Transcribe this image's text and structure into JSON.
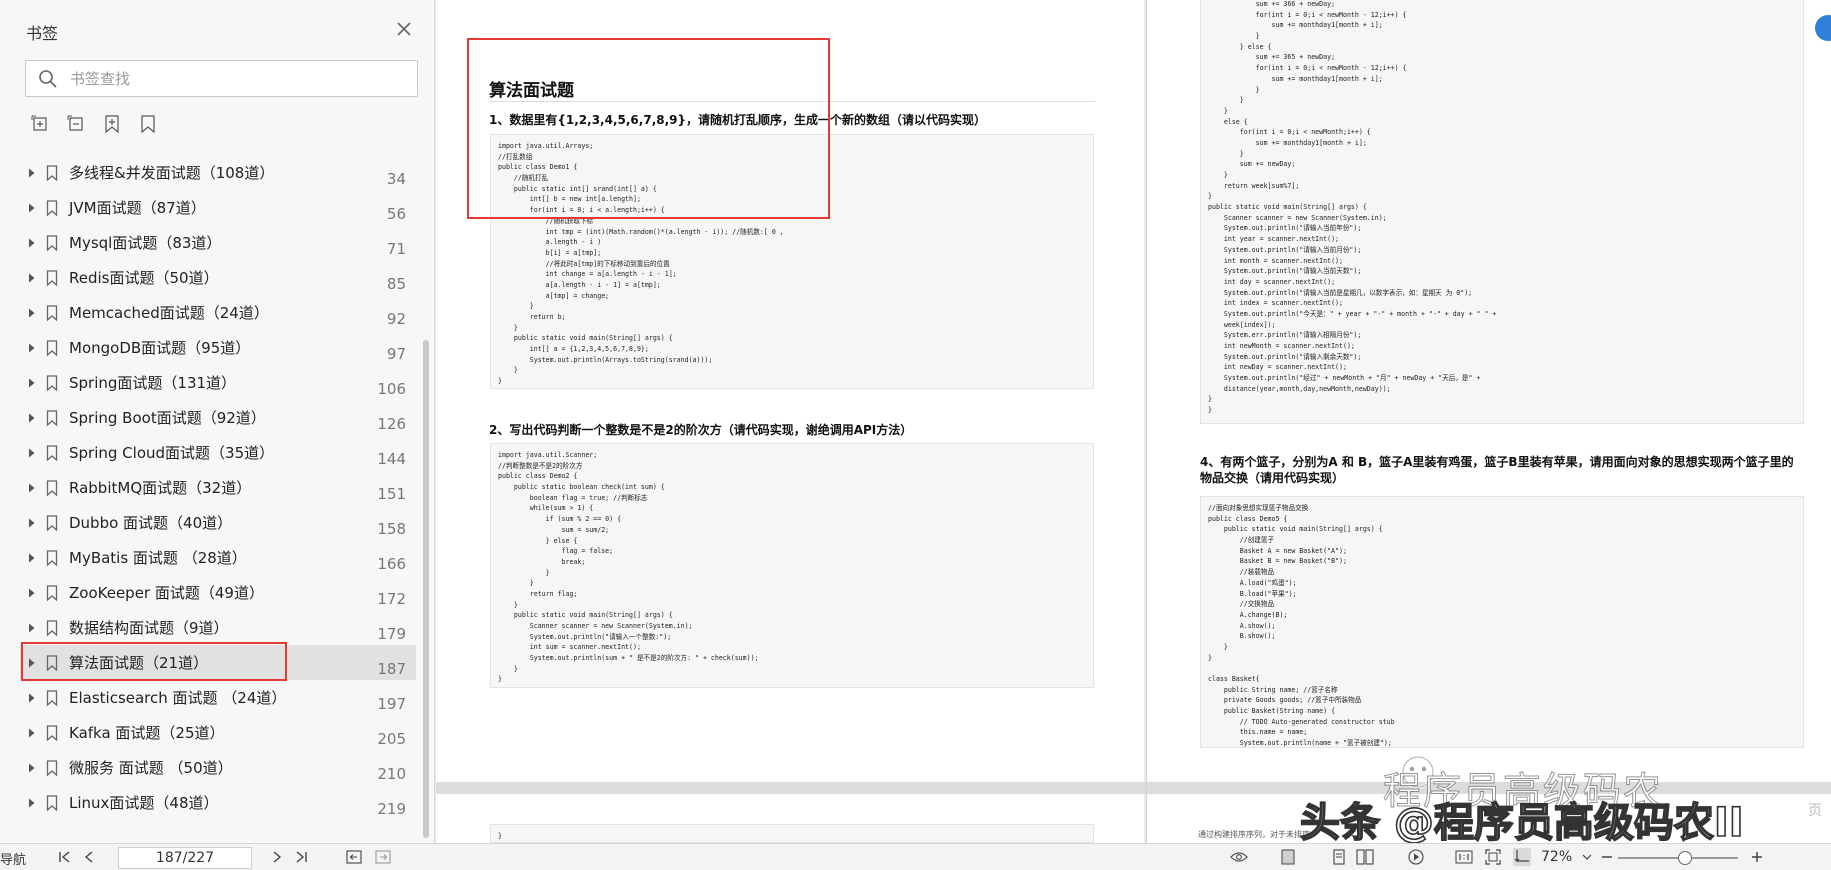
{
  "sidebar": {
    "title": "书签",
    "search_placeholder": "书签查找",
    "items": [
      {
        "label": "多线程&并发面试题（108道）",
        "page": "34"
      },
      {
        "label": "JVM面试题（87道）",
        "page": "56"
      },
      {
        "label": "Mysql面试题（83道）",
        "page": "71"
      },
      {
        "label": "Redis面试题（50道）",
        "page": "85"
      },
      {
        "label": "Memcached面试题（24道）",
        "page": "92"
      },
      {
        "label": "MongoDB面试题（95道）",
        "page": "97"
      },
      {
        "label": "Spring面试题（131道）",
        "page": "106"
      },
      {
        "label": "Spring Boot面试题（92道）",
        "page": "126"
      },
      {
        "label": "Spring Cloud面试题（35道）",
        "page": "144"
      },
      {
        "label": "RabbitMQ面试题（32道）",
        "page": "151"
      },
      {
        "label": "Dubbo 面试题（40道）",
        "page": "158"
      },
      {
        "label": "MyBatis 面试题 （28道）",
        "page": "166"
      },
      {
        "label": "ZooKeeper 面试题（49道）",
        "page": "172"
      },
      {
        "label": "数据结构面试题（9道）",
        "page": "179"
      },
      {
        "label": "算法面试题（21道）",
        "page": "187"
      },
      {
        "label": "Elasticsearch 面试题 （24道）",
        "page": "197"
      },
      {
        "label": "Kafka 面试题（25道）",
        "page": "205"
      },
      {
        "label": "微服务 面试题 （50道）",
        "page": "210"
      },
      {
        "label": "Linux面试题（48道）",
        "page": "219"
      }
    ],
    "active_index": 14
  },
  "doc": {
    "left_page": {
      "title": "算法面试题",
      "q1": "1、数据里有{1,2,3,4,5,6,7,8,9}，请随机打乱顺序，生成一个新的数组（请以代码实现）",
      "code1": [
        "import java.util.Arrays;",
        "//打乱数组",
        "public class Demo1 {",
        "    //随机打乱",
        "    public static int[] srand(int[] a) {",
        "        int[] b = new int[a.length];",
        "        for(int i = 0; i < a.length;i++) {",
        "            //随机获取下标",
        "            int tmp = (int)(Math.random()*(a.length - i)); //随机数:[ 0 ,",
        "            a.length - i )",
        "            b[i] = a[tmp];",
        "            //将此时a[tmp]的下标移动到靠后的位置",
        "            int change = a[a.length - i - 1];",
        "            a[a.length - i - 1] = a[tmp];",
        "            a[tmp] = change;",
        "        }",
        "        return b;",
        "    }",
        "    public static void main(String[] args) {",
        "        int[] a = {1,2,3,4,5,6,7,8,9};",
        "        System.out.println(Arrays.toString(srand(a)));",
        "    }",
        "}"
      ],
      "q2": "2、写出代码判断一个整数是不是2的阶次方（请代码实现，谢绝调用API方法）",
      "code2": [
        "import java.util.Scanner;",
        "//判断整数是不是2的阶次方",
        "public class Demo2 {",
        "    public static boolean check(int sum) {",
        "        boolean flag = true; //判断标志",
        "        while(sum > 1) {",
        "            if (sum % 2 == 0) {",
        "                sum = sum/2;",
        "            } else {",
        "                flag = false;",
        "                break;",
        "            }",
        "        }",
        "        return flag;",
        "    }",
        "    public static void main(String[] args) {",
        "        Scanner scanner = new Scanner(System.in);",
        "        System.out.println(\"请输入一个整数:\");",
        "        int sum = scanner.nextInt();",
        "        System.out.println(sum + \" 是不是2的阶次方: \" + check(sum));",
        "    }",
        "}"
      ],
      "code3_fragment": "}"
    },
    "right_page": {
      "code_top": [
        "            sum += 366 + newDay;",
        "            for(int i = 0;i < newMonth - 12;i++) {",
        "                sum += monthday1[month + i];",
        "            }",
        "        } else {",
        "            sum += 365 + newDay;",
        "            for(int i = 0;i < newMonth - 12;i++) {",
        "                sum += monthday1[month + i];",
        "            }",
        "        }",
        "    }",
        "    else {",
        "        for(int i = 0;i < newMonth;i++) {",
        "            sum += monthday1[month + i];",
        "        }",
        "        sum += newDay;",
        "    }",
        "    return week[sum%7];",
        "}",
        "public static void main(String[] args) {",
        "    Scanner scanner = new Scanner(System.in);",
        "    System.out.println(\"请输入当前年份\");",
        "    int year = scanner.nextInt();",
        "    System.out.println(\"请输入当前月份\");",
        "    int month = scanner.nextInt();",
        "    System.out.println(\"请输入当前天数\");",
        "    int day = scanner.nextInt();",
        "    System.out.println(\"请输入当前是星期几，以数字表示，如：星期天 为 0\");",
        "    int index = scanner.nextInt();",
        "    System.out.println(\"今天是：\" + year + \"-\" + month + \"-\" + day + \" \" +",
        "    week[index]);",
        "    System.err.println(\"请输入相隔月份\");",
        "    int newMonth = scanner.nextInt();",
        "    System.out.println(\"请输入剩余天数\");",
        "    int newDay = scanner.nextInt();",
        "    System.out.println(\"经过\" + newMonth + \"月\" + newDay + \"天后，是\" +",
        "    distance(year,month,day,newMonth,newDay));",
        "}",
        "}"
      ],
      "q4": "4、有两个篮子，分别为A 和 B，篮子A里装有鸡蛋，篮子B里装有苹果，请用面向对象的思想实现两个篮子里的物品交换（请用代码实现）",
      "code4": [
        "//面向对象思想实现篮子物品交换",
        "public class Demo5 {",
        "    public static void main(String[] args) {",
        "        //创建篮子",
        "        Basket A = new Basket(\"A\");",
        "        Basket B = new Basket(\"B\");",
        "        //装载物品",
        "        A.load(\"鸡蛋\");",
        "        B.load(\"苹果\");",
        "        //交换物品",
        "        A.change(B);",
        "        A.show();",
        "        B.show();",
        "    }",
        "}",
        "",
        "class Basket{",
        "    public String name; //篮子名称",
        "    private Goods goods; //篮子中所装物品",
        "    public Basket(String name) {",
        "        // TODO Auto-generated constructor stub",
        "        this.name = name;",
        "        System.out.println(name + \"篮子被创建\");"
      ],
      "bottom_text": "通过构建排序序列，对于未排序"
    },
    "watermark_top": "程序员高级码农",
    "watermark_main": "头条 @程序员高级码农II",
    "watermark_suffix": "页"
  },
  "statusbar": {
    "nav_label": "导航",
    "page_value": "187/227",
    "zoom": "72%"
  },
  "colors": {
    "highlight_red": "#e53935",
    "active_row": "#e1e1e1",
    "accent_blue": "#2f7fd9"
  },
  "icons": [
    "close-icon",
    "search-icon",
    "add-bookmark-icon",
    "remove-bookmark-icon",
    "bookmark-add-icon",
    "bookmark-icon",
    "caret-right-icon",
    "first-page-icon",
    "prev-page-icon",
    "next-page-icon",
    "last-page-icon",
    "eye-icon",
    "zoom-out-icon",
    "zoom-in-icon"
  ]
}
